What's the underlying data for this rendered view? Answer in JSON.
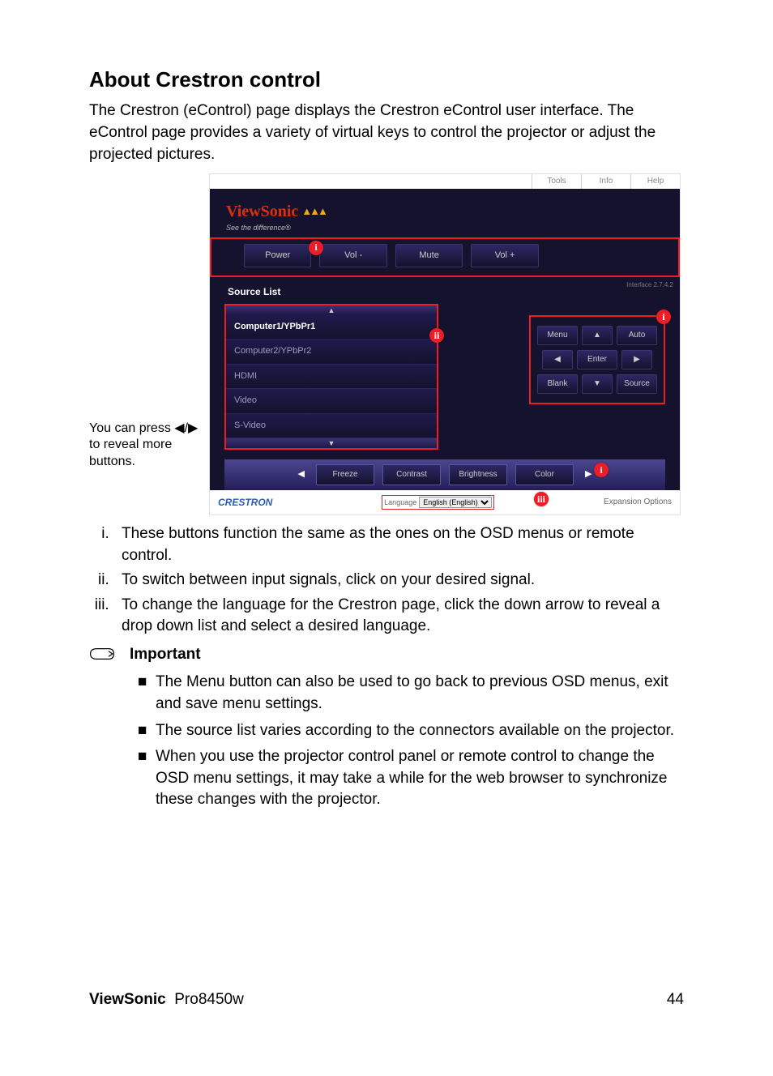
{
  "heading": "About Crestron control",
  "intro": "The Crestron (eControl) page displays the Crestron eControl user interface. The eControl page provides a variety of virtual keys to control the projector or adjust the projected pictures.",
  "figure_caption": "You can press ◀/▶ to reveal more buttons.",
  "topbar": {
    "tools": "Tools",
    "info": "Info",
    "help": "Help"
  },
  "brand": {
    "name": "ViewSonic",
    "tagline": "See the difference®",
    "birds": "▲▲▲"
  },
  "power_row": {
    "power": "Power",
    "vol_minus": "Vol -",
    "mute": "Mute",
    "vol_plus": "Vol +",
    "marker": "i"
  },
  "interface_label": "Interface 2.7.4.2",
  "source_list": {
    "label": "Source List",
    "marker": "ii",
    "items": [
      "Computer1/YPbPr1",
      "Computer2/YPbPr2",
      "HDMI",
      "Video",
      "S-Video"
    ]
  },
  "osd": {
    "marker": "i",
    "menu": "Menu",
    "auto": "Auto",
    "enter": "Enter",
    "blank": "Blank",
    "source": "Source"
  },
  "adjust": {
    "marker": "i",
    "freeze": "Freeze",
    "contrast": "Contrast",
    "brightness": "Brightness",
    "color": "Color"
  },
  "footer": {
    "crestron": "CRESTRON",
    "marker": "iii",
    "lang_label": "Language",
    "lang_value": "English (English)",
    "expansion": "Expansion Options"
  },
  "explain": {
    "i": "These buttons function the same as the ones on the OSD menus or remote control.",
    "ii": "To switch between input signals, click on your desired signal.",
    "iii": "To change the language for the Crestron page, click the down arrow to reveal a drop down list and select a desired language."
  },
  "important_label": "Important",
  "bullets": [
    "The Menu button can also be used to go back to previous OSD menus, exit and save menu settings.",
    "The source list varies according to the connectors available on the projector.",
    "When you use the projector control panel or remote control to change the OSD menu settings, it may take a while for the web browser to synchronize these changes with the projector."
  ],
  "pagefoot": {
    "brand": "ViewSonic",
    "model": "Pro8450w",
    "page": "44"
  }
}
